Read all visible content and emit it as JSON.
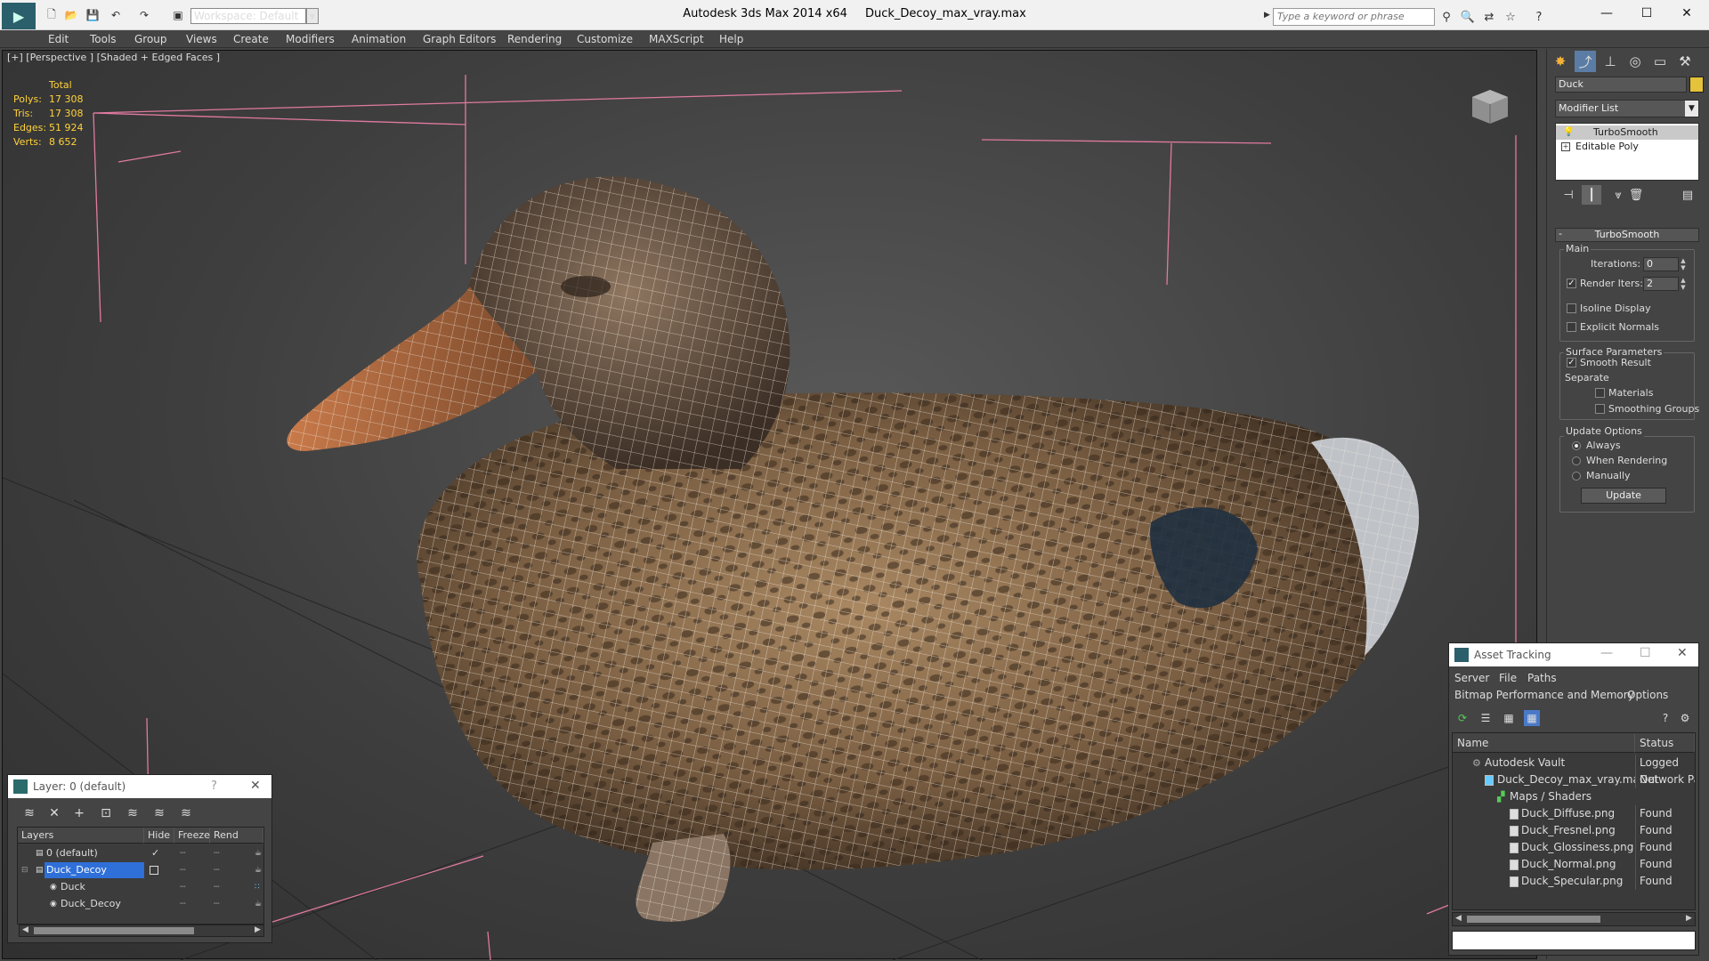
{
  "titlebar": {
    "app_name": "Autodesk 3ds Max  2014 x64",
    "file_name": "Duck_Decoy_max_vray.max",
    "workspace": "Workspace: Default",
    "search_placeholder": "Type a keyword or phrase"
  },
  "menu": [
    "Edit",
    "Tools",
    "Group",
    "Views",
    "Create",
    "Modifiers",
    "Animation",
    "Graph Editors",
    "Rendering",
    "Customize",
    "MAXScript",
    "Help"
  ],
  "viewport": {
    "label": "[+] [Perspective ] [Shaded + Edged Faces ]",
    "stats": {
      "header": "Total",
      "rows": [
        {
          "label": "Polys:",
          "value": "17 308"
        },
        {
          "label": "Tris:",
          "value": "17 308"
        },
        {
          "label": "Edges:",
          "value": "51 924"
        },
        {
          "label": "Verts:",
          "value": "8 652"
        }
      ]
    }
  },
  "command_panel": {
    "object_name": "Duck",
    "object_color": "#e4c23a",
    "modifier_list": "Modifier List",
    "stack": [
      "TurboSmooth",
      "Editable Poly"
    ],
    "rollout": {
      "title": "TurboSmooth",
      "main_group": "Main",
      "iterations_label": "Iterations:",
      "iterations_value": "0",
      "render_iters_label": "Render Iters:",
      "render_iters_value": "2",
      "render_iters_checked": true,
      "isoline_label": "Isoline Display",
      "explicit_normals_label": "Explicit Normals",
      "surface_group": "Surface Parameters",
      "smooth_result_label": "Smooth Result",
      "separate_label": "Separate",
      "materials_label": "Materials",
      "smoothing_groups_label": "Smoothing Groups",
      "update_group": "Update Options",
      "always_label": "Always",
      "when_rendering_label": "When Rendering",
      "manually_label": "Manually",
      "update_button": "Update"
    }
  },
  "layer_window": {
    "title": "Layer: 0 (default)",
    "columns": [
      "Layers",
      "Hide",
      "Freeze",
      "Rend"
    ],
    "rows": [
      {
        "name": "0 (default)",
        "level": 0,
        "active": true
      },
      {
        "name": "Duck_Decoy",
        "level": 0,
        "selected": true
      },
      {
        "name": "Duck",
        "level": 1
      },
      {
        "name": "Duck_Decoy",
        "level": 1
      }
    ]
  },
  "asset_tracking": {
    "title": "Asset Tracking",
    "menu": [
      "Server",
      "File",
      "Paths"
    ],
    "menu2": [
      "Bitmap Performance and Memory",
      "Options"
    ],
    "columns": [
      "Name",
      "Status"
    ],
    "rows": [
      {
        "name": "Autodesk Vault",
        "status": "Logged Out",
        "level": 0
      },
      {
        "name": "Duck_Decoy_max_vray.max",
        "status": "Network Pat",
        "level": 1
      },
      {
        "name": "Maps / Shaders",
        "status": "",
        "level": 2
      },
      {
        "name": "Duck_Diffuse.png",
        "status": "Found",
        "level": 3
      },
      {
        "name": "Duck_Fresnel.png",
        "status": "Found",
        "level": 3
      },
      {
        "name": "Duck_Glossiness.png",
        "status": "Found",
        "level": 3
      },
      {
        "name": "Duck_Normal.png",
        "status": "Found",
        "level": 3
      },
      {
        "name": "Duck_Specular.png",
        "status": "Found",
        "level": 3
      }
    ]
  }
}
